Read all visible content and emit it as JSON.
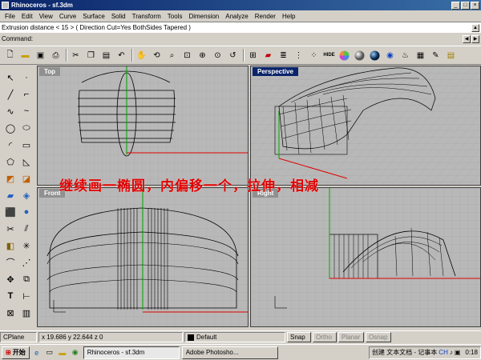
{
  "window": {
    "title": "Rhinoceros - sf.3dm"
  },
  "menu": [
    "File",
    "Edit",
    "View",
    "Curve",
    "Surface",
    "Solid",
    "Transform",
    "Tools",
    "Dimension",
    "Analyze",
    "Render",
    "Help"
  ],
  "command": {
    "history": "Extrusion distance < 15 > ( Direction  Cut=Yes  BothSides  Tapered )",
    "prompt": "Command:"
  },
  "toolbar": {
    "icons": [
      "new-file-icon",
      "open-folder-icon",
      "save-icon",
      "print-icon",
      "cut-icon",
      "copy-icon",
      "paste-icon",
      "undo-icon",
      "pan-hand-icon",
      "rotate-view-icon",
      "zoom-icon",
      "zoom-window-icon",
      "zoom-extents-icon",
      "zoom-selected-icon",
      "undo-view-icon",
      "four-viewports-icon",
      "car-icon",
      "layers-icon",
      "properties-icon",
      "points-on-icon",
      "hide-icon",
      "color-wheel-icon",
      "sphere-render-icon",
      "blue-sphere-icon",
      "globe-icon",
      "teapot-icon",
      "render-settings-icon",
      "pencil-icon",
      "notes-icon"
    ]
  },
  "viewports": {
    "top": {
      "label": "Top"
    },
    "perspective": {
      "label": "Perspective"
    },
    "front": {
      "label": "Front"
    },
    "right": {
      "label": "Right"
    }
  },
  "overlay_text": "继续画一椭圆，内偏移一个，拉伸，相减",
  "statusbar": {
    "cplane": "CPlane",
    "coords": "x 19.686  y 22.644  z 0",
    "layer": "Default",
    "snap": "Snap",
    "ortho": "Ortho",
    "planar": "Planar",
    "osnap": "Osnap"
  },
  "taskbar": {
    "start": "开始",
    "tasks": [
      "Rhinoceros - sf.3dm",
      "Adobe Photosho..."
    ],
    "tray_text": "创建 文本文档 - 记事本",
    "clock": "0:18"
  },
  "colors": {
    "title_bar": "#0a246a",
    "overlay_text": "#e00000",
    "viewport_bg": "#b8b8b8",
    "active_label": "#0a246a"
  }
}
